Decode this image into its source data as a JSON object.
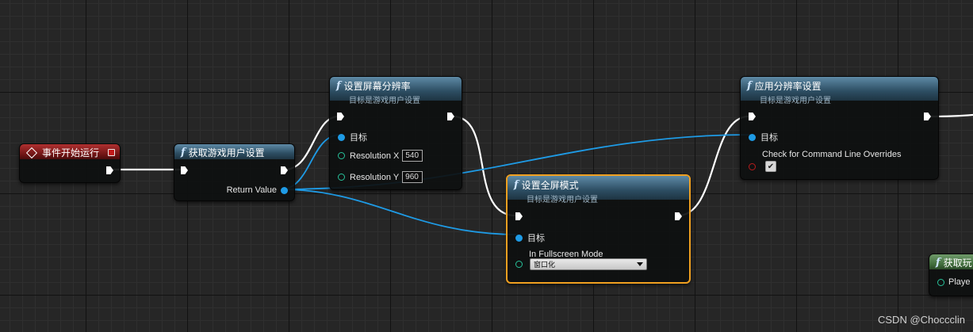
{
  "nodes": {
    "begin_play": {
      "title": "事件开始运行"
    },
    "get_user_settings": {
      "title": "获取游戏用户设置",
      "return_label": "Return Value"
    },
    "set_resolution": {
      "title": "设置屏幕分辨率",
      "subtitle": "目标是游戏用户设置",
      "target_label": "目标",
      "res_x_label": "Resolution X",
      "res_x_value": "540",
      "res_y_label": "Resolution Y",
      "res_y_value": "960"
    },
    "set_fullscreen": {
      "title": "设置全屏模式",
      "subtitle": "目标是游戏用户设置",
      "target_label": "目标",
      "mode_label": "In Fullscreen Mode",
      "mode_value": "窗口化"
    },
    "apply_resolution": {
      "title": "应用分辨率设置",
      "subtitle": "目标是游戏用户设置",
      "target_label": "目标",
      "override_label": "Check for Command Line Overrides",
      "override_checked": true
    },
    "get_player": {
      "title": "获取玩",
      "pin_label": "Playe"
    }
  },
  "colors": {
    "exec_wire": "#ffffff",
    "object_wire": "#1e9be6",
    "selected_border": "#f0a020",
    "function_header": "#2d4e63",
    "event_header": "#8a1c1c",
    "pure_header": "#3e6a3a"
  },
  "icons": {
    "function": "function-f-icon",
    "event": "event-diamond-icon",
    "exec_pin": "exec-arrow-icon",
    "object_pin": "object-dot-icon"
  },
  "watermark": "CSDN @Choccclin"
}
